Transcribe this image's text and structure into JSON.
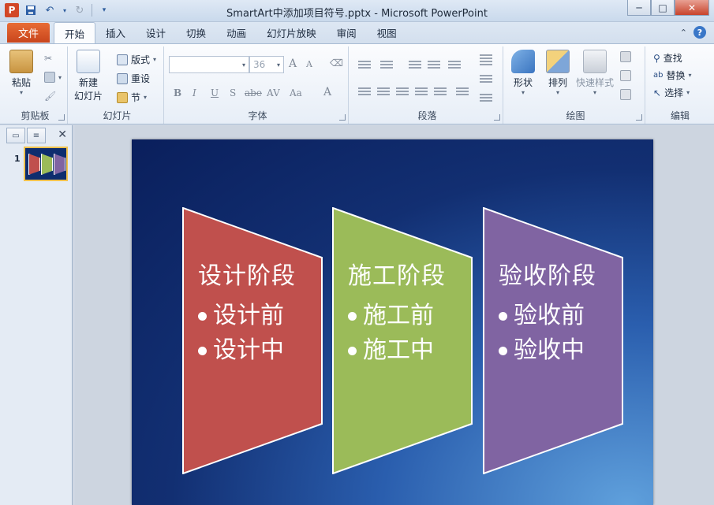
{
  "window": {
    "title": "SmartArt中添加项目符号.pptx - Microsoft PowerPoint",
    "app_icon": "P",
    "controls": [
      "─",
      "□",
      "✕"
    ]
  },
  "tabs": {
    "file": "文件",
    "items": [
      "开始",
      "插入",
      "设计",
      "切换",
      "动画",
      "幻灯片放映",
      "审阅",
      "视图"
    ]
  },
  "ribbon": {
    "clipboard": {
      "label": "剪贴板",
      "paste": "粘贴"
    },
    "slides": {
      "label": "幻灯片",
      "new_slide_line1": "新建",
      "new_slide_line2": "幻灯片",
      "layout": "版式",
      "reset": "重设",
      "section": "节"
    },
    "font": {
      "label": "字体",
      "font_name": "",
      "font_size": "36",
      "bold": "B",
      "italic": "I",
      "underline": "U",
      "shadow": "S",
      "strike": "abe",
      "spacing": "AV",
      "case": "Aa",
      "color": "A",
      "grow": "A",
      "shrink": "A"
    },
    "paragraph": {
      "label": "段落"
    },
    "drawing": {
      "label": "绘图",
      "shapes": "形状",
      "arrange": "排列",
      "quick_styles": "快速样式"
    },
    "editing": {
      "label": "编辑",
      "find": "查找",
      "replace": "替换",
      "select": "选择"
    }
  },
  "thumbnails": {
    "slide_number": "1"
  },
  "slide": {
    "panels": [
      {
        "title": "设计阶段",
        "bullets": [
          "设计前",
          "设计中"
        ],
        "color": "#c0504d"
      },
      {
        "title": "施工阶段",
        "bullets": [
          "施工前",
          "施工中"
        ],
        "color": "#9bbb59"
      },
      {
        "title": "验收阶段",
        "bullets": [
          "验收前",
          "验收中"
        ],
        "color": "#8064a2"
      }
    ]
  },
  "colors": {
    "accent_file_tab": "#d24726",
    "slide_bg_dark": "#0a1f5c",
    "slide_bg_light": "#5fa0dc"
  }
}
